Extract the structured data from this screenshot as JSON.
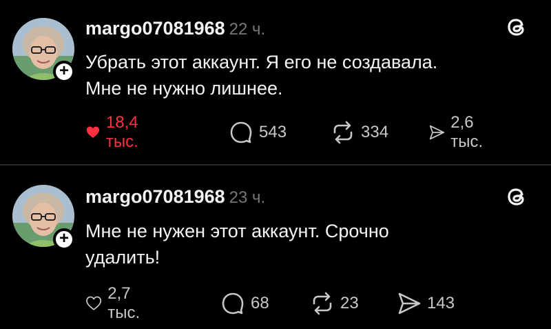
{
  "posts": [
    {
      "username": "margo07081968",
      "time": "22 ч.",
      "text_line1": "Убрать этот аккаунт. Я его не создавала.",
      "text_line2": "Мне не нужно лишнее.",
      "likes": "18,4 тыс.",
      "liked": true,
      "replies": "543",
      "reposts": "334",
      "shares": "2,6 тыс."
    },
    {
      "username": "margo07081968",
      "time": "23 ч.",
      "text_line1": "Мне не нужен этот аккаунт. Срочно",
      "text_line2": "удалить!",
      "likes": "2,7 тыс.",
      "liked": false,
      "replies": "68",
      "reposts": "23",
      "shares": "143"
    }
  ],
  "colors": {
    "like_active": "#ff3040",
    "text": "#f3f5f7",
    "muted": "#777777",
    "background": "#000000"
  },
  "icons": [
    "avatar",
    "follow-plus-icon",
    "threads-logo-icon",
    "heart-icon",
    "reply-icon",
    "repost-icon",
    "share-icon"
  ]
}
